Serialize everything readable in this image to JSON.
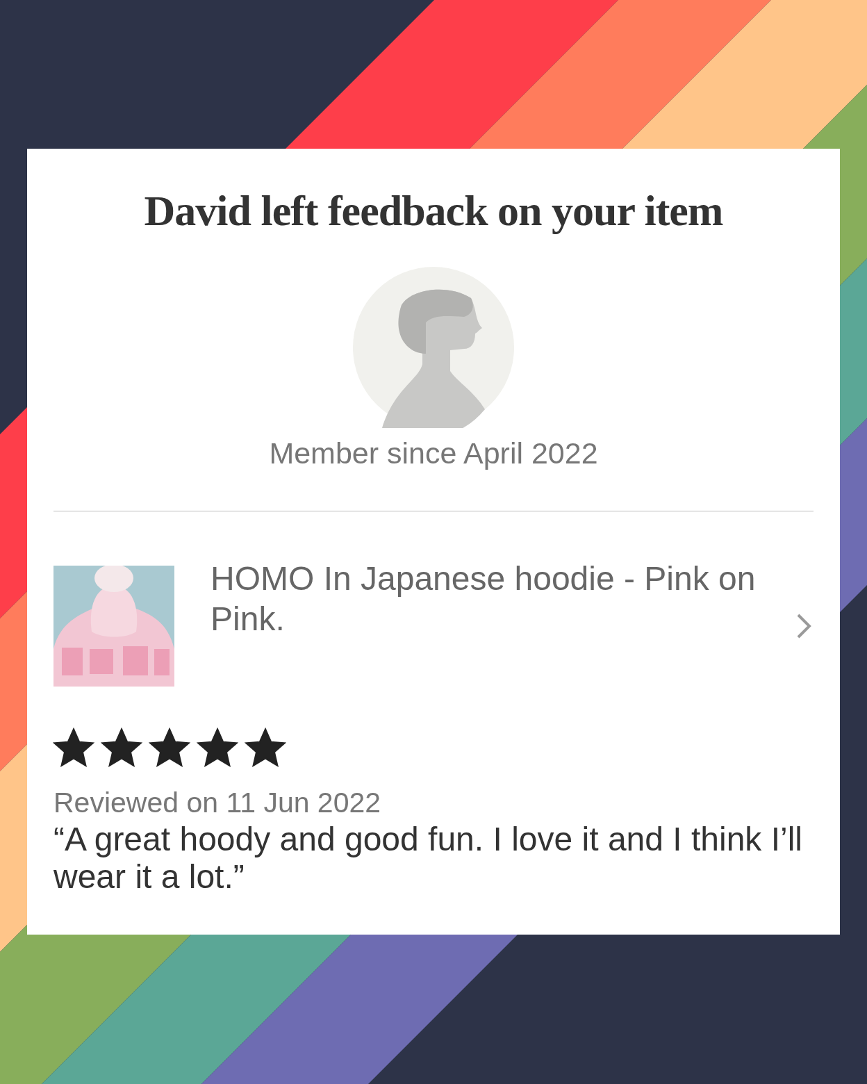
{
  "notification": {
    "title": "David left feedback on your item",
    "member_since": "Member since April 2022"
  },
  "item": {
    "title": "HOMO In Japanese hoodie - Pink on Pink."
  },
  "review": {
    "stars": 5,
    "date": "Reviewed on 11 Jun 2022",
    "text": "“A great hoody and good fun. I love it and I think I’ll wear it a lot.”"
  }
}
